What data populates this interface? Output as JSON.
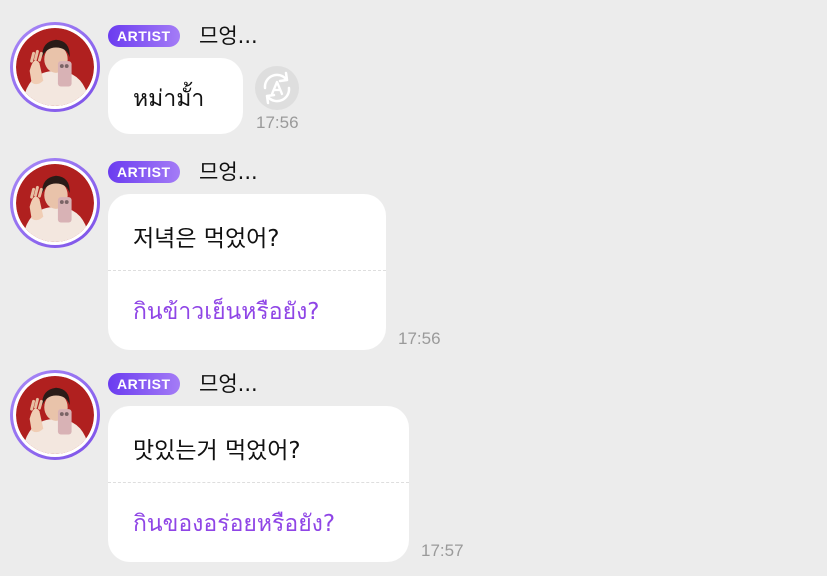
{
  "messages": [
    {
      "badge": "ARTIST",
      "sender": "므엉...",
      "text": "หม่ามั้า",
      "translation": "",
      "time": "17:56",
      "translate_icon": "translate-icon"
    },
    {
      "badge": "ARTIST",
      "sender": "므엉...",
      "text": "저녁은 먹었어?",
      "translation": "กินข้าวเย็นหรือยัง?",
      "time": "17:56"
    },
    {
      "badge": "ARTIST",
      "sender": "므엉...",
      "text": "맛있는거 먹었어?",
      "translation": "กินของอร่อยหรือยัง?",
      "time": "17:57"
    }
  ],
  "colors": {
    "background": "#ececec",
    "badge_start": "#6b3cf0",
    "badge_end": "#a47cf6",
    "translation_text": "#8f45e6",
    "timestamp": "#9a9a9a"
  }
}
